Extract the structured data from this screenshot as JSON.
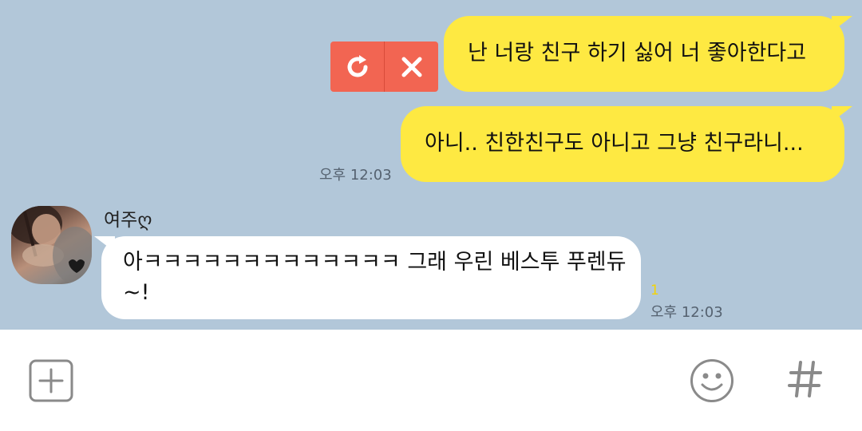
{
  "messages": {
    "sent_1": {
      "text": "난 너랑 친구 하기 싫어 너 좋아한다고"
    },
    "sent_2": {
      "text": "아니.. 친한친구도 아니고 그냥 친구라니...",
      "time": "오후 12:03"
    },
    "received_1": {
      "sender": "여주ღ",
      "text": "아ㅋㅋㅋㅋㅋㅋㅋㅋㅋㅋㅋㅋㅋ 그래 우린 베스투 푸렌듀~!",
      "unread_count": "1",
      "time": "오후 12:03"
    }
  },
  "failed_send": {
    "retry_icon": "refresh-icon",
    "cancel_icon": "close-icon"
  },
  "input_bar": {
    "attach_icon": "plus-icon",
    "emoji_icon": "smiley-icon",
    "hashtag_icon": "hash-icon"
  },
  "colors": {
    "chat_background": "#b2c7d9",
    "my_bubble": "#fee942",
    "their_bubble": "#ffffff",
    "failed_box": "#f26552",
    "unread": "#f5d400"
  }
}
